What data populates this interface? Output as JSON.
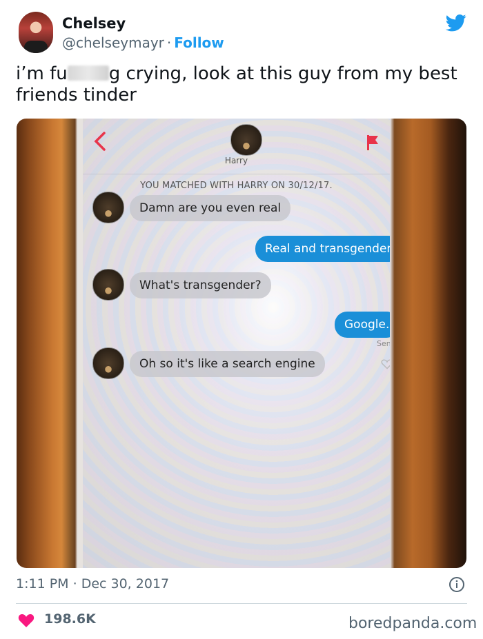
{
  "author": {
    "display_name": "Chelsey",
    "handle": "@chelseymayr",
    "separator": "·",
    "follow_label": "Follow"
  },
  "tweet": {
    "text_before": "i’m fu",
    "text_after": "g crying, look at this guy from my best friends tinder"
  },
  "screenshot": {
    "match_name": "Harry",
    "match_info": "YOU MATCHED WITH HARRY ON 30/12/17.",
    "messages": [
      {
        "from": "them",
        "text": "Damn are you even real"
      },
      {
        "from": "me",
        "text": "Real and transgender"
      },
      {
        "from": "them",
        "text": "What's transgender?"
      },
      {
        "from": "me",
        "text": "Google."
      },
      {
        "from": "them",
        "text": "Oh so it's like a search engine"
      }
    ],
    "sent_label": "Sent",
    "accent_color": "#1a8fd8",
    "flag_color": "#e8344a"
  },
  "meta": {
    "time": "1:11 PM",
    "separator": "·",
    "date": "Dec 30, 2017",
    "likes": "198.6K"
  },
  "watermark": "boredpanda.com",
  "colors": {
    "twitter_blue": "#1d9bf0",
    "like_pink": "#f91880"
  },
  "icons": [
    "twitter-bird-icon",
    "back-chevron-icon",
    "report-flag-icon",
    "info-icon",
    "heart-icon"
  ]
}
